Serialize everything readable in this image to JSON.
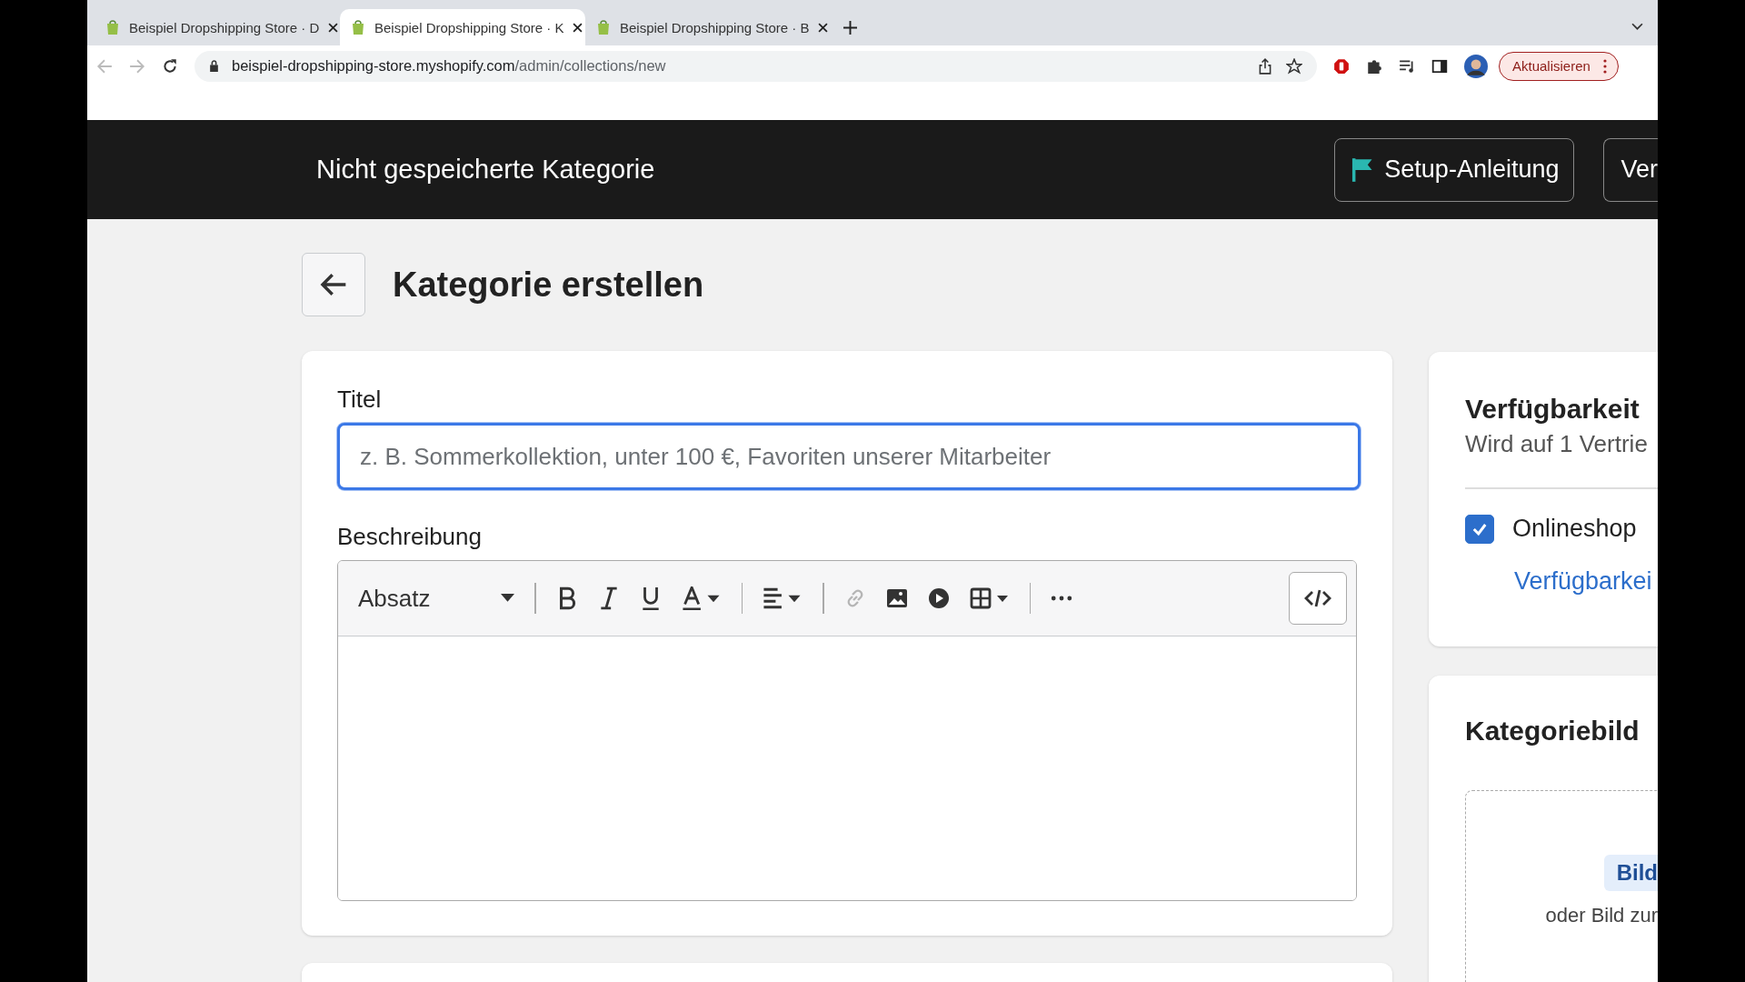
{
  "browser": {
    "tabs": [
      {
        "title": "Beispiel Dropshipping Store · D",
        "selected": false
      },
      {
        "title": "Beispiel Dropshipping Store · K",
        "selected": true
      },
      {
        "title": "Beispiel Dropshipping Store · B",
        "selected": false
      }
    ],
    "url": {
      "host": "beispiel-dropshipping-store.myshopify.com",
      "path": "/admin/collections/new"
    },
    "update_button": "Aktualisieren"
  },
  "header": {
    "title": "Nicht gespeicherte Kategorie",
    "buttons": [
      {
        "label": "Setup-Anleitung",
        "kind": "flag"
      },
      {
        "label": "Ver",
        "kind": "plain"
      }
    ]
  },
  "page": {
    "title": "Kategorie erstellen"
  },
  "title_field": {
    "label": "Titel",
    "placeholder": "z. B. Sommerkollektion, unter 100 €, Favoriten unserer Mitarbeiter",
    "focused": true
  },
  "description": {
    "label": "Beschreibung",
    "paragraph_style": "Absatz",
    "tools": [
      {
        "kind": "bold",
        "disabled": false
      },
      {
        "kind": "italic",
        "disabled": false
      },
      {
        "kind": "underline",
        "disabled": false
      },
      {
        "kind": "color",
        "disabled": false
      },
      {
        "kind": "sep"
      },
      {
        "kind": "align",
        "disabled": false
      },
      {
        "kind": "sep"
      },
      {
        "kind": "link",
        "disabled": true
      },
      {
        "kind": "image",
        "disabled": false
      },
      {
        "kind": "video",
        "disabled": false
      },
      {
        "kind": "table",
        "disabled": false
      },
      {
        "kind": "sep"
      },
      {
        "kind": "more",
        "disabled": false
      }
    ]
  },
  "availability": {
    "heading": "Verfügbarkeit",
    "subtitle": "Wird auf 1 Vertrie",
    "channels": [
      {
        "label": "Onlineshop",
        "checked": true
      }
    ],
    "link": "Verfügbarkei"
  },
  "image": {
    "heading": "Kategoriebild",
    "button": "Bild",
    "hint": "oder Bild zur"
  }
}
